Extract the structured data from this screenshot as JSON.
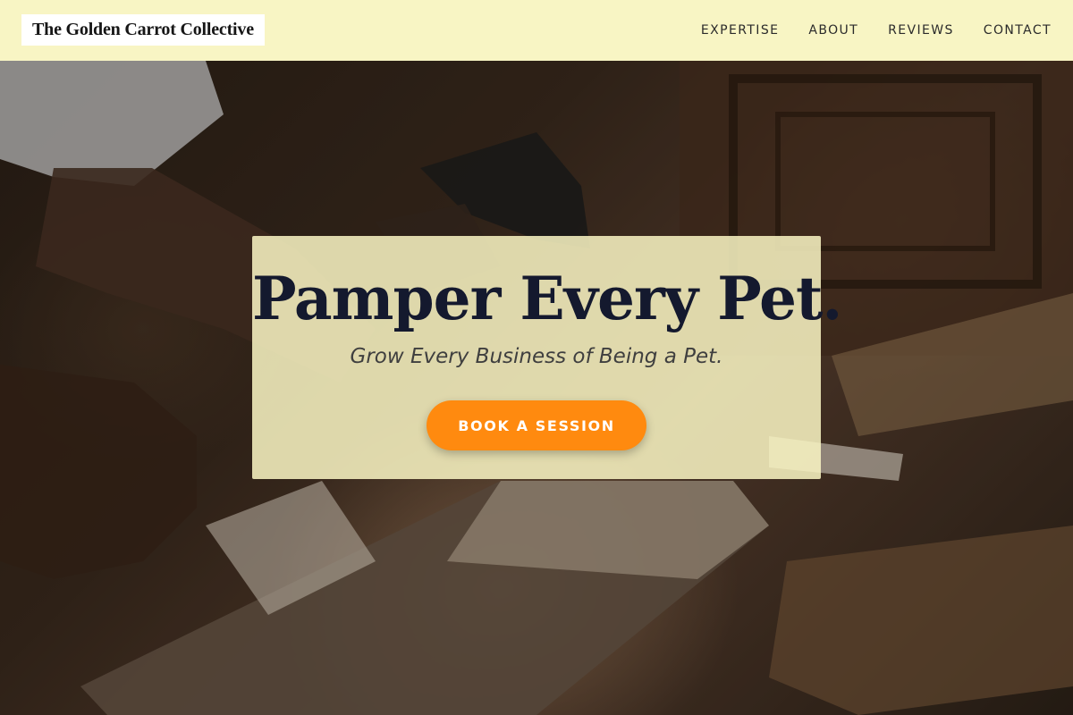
{
  "header": {
    "brand": "The Golden Carrot Collective",
    "nav": [
      {
        "label": "EXPERTISE"
      },
      {
        "label": "ABOUT"
      },
      {
        "label": "REVIEWS"
      },
      {
        "label": "CONTACT"
      }
    ]
  },
  "hero": {
    "background_image": "woodcarving-workshop-photo",
    "title": "Pamper Every Pet.",
    "subtitle": "Grow Every Business of Being a Pet.",
    "cta_label": "BOOK A SESSION"
  },
  "colors": {
    "header_bg": "#f8f5c4",
    "card_bg": "#faf6c4",
    "title_text": "#14192e",
    "cta_bg": "#ff8a0f",
    "cta_text": "#ffffff"
  }
}
